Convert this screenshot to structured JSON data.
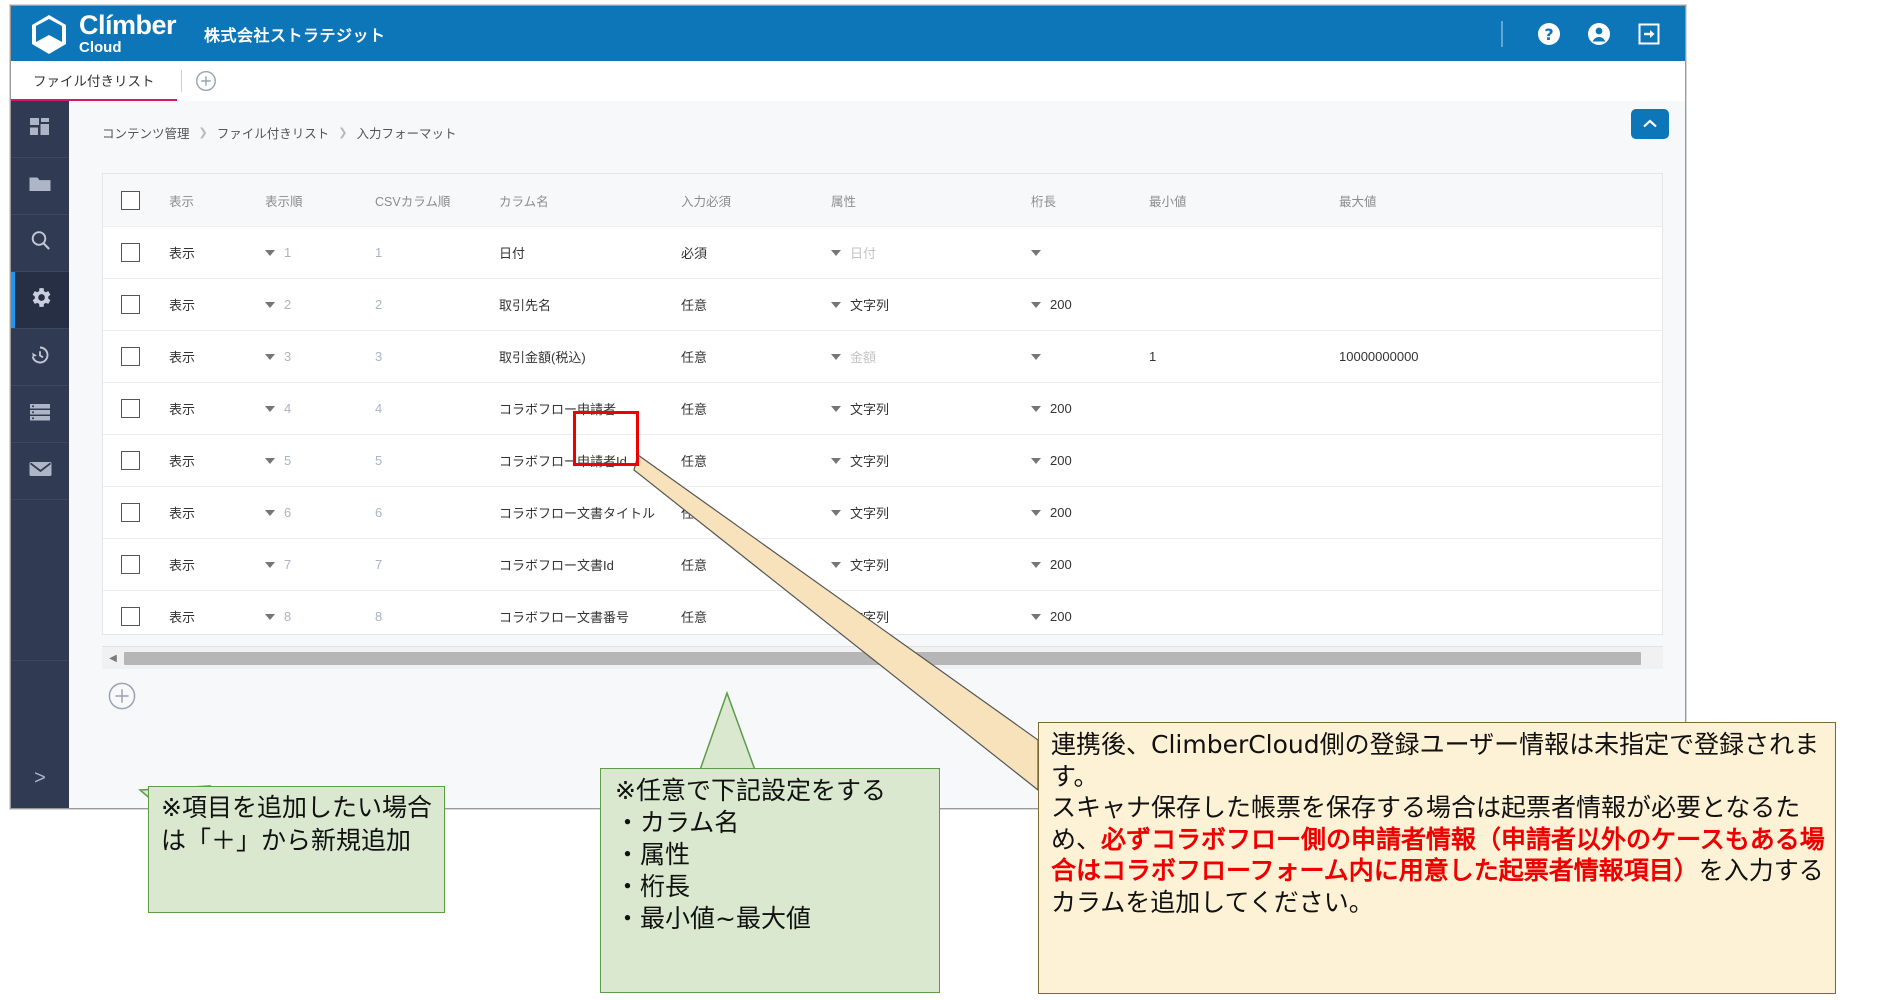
{
  "header": {
    "logo_line1": "Clímber",
    "logo_line2": "Cloud",
    "org_name": "株式会社ストラテジット",
    "icons": [
      "help-icon",
      "account-icon",
      "logout-icon"
    ]
  },
  "tabs": {
    "active_label": "ファイル付きリスト",
    "add_tab_label": "+"
  },
  "sidebar": {
    "items": [
      {
        "name": "dashboard-icon",
        "active": false
      },
      {
        "name": "folder-icon",
        "active": false
      },
      {
        "name": "search-icon",
        "active": false
      },
      {
        "name": "gear-icon",
        "active": true
      },
      {
        "name": "history-icon",
        "active": false
      },
      {
        "name": "list-icon",
        "active": false
      },
      {
        "name": "mail-icon",
        "active": false
      }
    ],
    "expand_label": ">"
  },
  "breadcrumb": [
    "コンテンツ管理",
    "ファイル付きリスト",
    "入力フォーマット"
  ],
  "table": {
    "columns": [
      "表示",
      "表示順",
      "CSVカラム順",
      "カラム名",
      "入力必須",
      "属性",
      "桁長",
      "最小値",
      "最大値"
    ],
    "rows": [
      {
        "show": "表示",
        "order": "1",
        "csv": "1",
        "colname": "日付",
        "required": "必須",
        "attr": "日付",
        "attr_placeholder": true,
        "len": "",
        "min": "",
        "max": ""
      },
      {
        "show": "表示",
        "order": "2",
        "csv": "2",
        "colname": "取引先名",
        "required": "任意",
        "attr": "文字列",
        "attr_placeholder": false,
        "len": "200",
        "min": "",
        "max": ""
      },
      {
        "show": "表示",
        "order": "3",
        "csv": "3",
        "colname": "取引金額(税込)",
        "required": "任意",
        "attr": "金額",
        "attr_placeholder": true,
        "len": "",
        "min": "1",
        "max": "10000000000"
      },
      {
        "show": "表示",
        "order": "4",
        "csv": "4",
        "colname": "コラボフロー申請者",
        "required": "任意",
        "attr": "文字列",
        "attr_placeholder": false,
        "len": "200",
        "min": "",
        "max": ""
      },
      {
        "show": "表示",
        "order": "5",
        "csv": "5",
        "colname": "コラボフロー申請者Id",
        "required": "任意",
        "attr": "文字列",
        "attr_placeholder": false,
        "len": "200",
        "min": "",
        "max": ""
      },
      {
        "show": "表示",
        "order": "6",
        "csv": "6",
        "colname": "コラボフロー文書タイトル",
        "required": "任意",
        "attr": "文字列",
        "attr_placeholder": false,
        "len": "200",
        "min": "",
        "max": ""
      },
      {
        "show": "表示",
        "order": "7",
        "csv": "7",
        "colname": "コラボフロー文書Id",
        "required": "任意",
        "attr": "文字列",
        "attr_placeholder": false,
        "len": "200",
        "min": "",
        "max": ""
      },
      {
        "show": "表示",
        "order": "8",
        "csv": "8",
        "colname": "コラボフロー文書番号",
        "required": "任意",
        "attr": "文字列",
        "attr_placeholder": false,
        "len": "200",
        "min": "",
        "max": ""
      }
    ]
  },
  "annotations": {
    "green_1": "※項目を追加したい場合は「＋」から新規追加",
    "green_2_title": "※任意で下記設定をする",
    "green_2_items": [
      "・カラム名",
      "・属性",
      "・桁長",
      "・最小値~最大値"
    ],
    "yellow_part1": "連携後、ClimberCloud側の登録ユーザー情報は未指定で登録されます。\nスキャナ保存した帳票を保存する場合は起票者情報が必要となるため、",
    "yellow_bold": "必ずコラボフロー側の申請者情報（申請者以外のケースもある場合はコラボフローフォーム内に用意した起票者情報項目）",
    "yellow_part2": "を入力するカラムを追加してください。"
  },
  "colors": {
    "brand_blue": "#0c76b8",
    "sidebar": "#313a53",
    "tab_underline": "#d6176b",
    "highlight_red": "#ee0000",
    "callout_green": "#d9e8cf",
    "callout_yellow": "#fdf2d5"
  }
}
